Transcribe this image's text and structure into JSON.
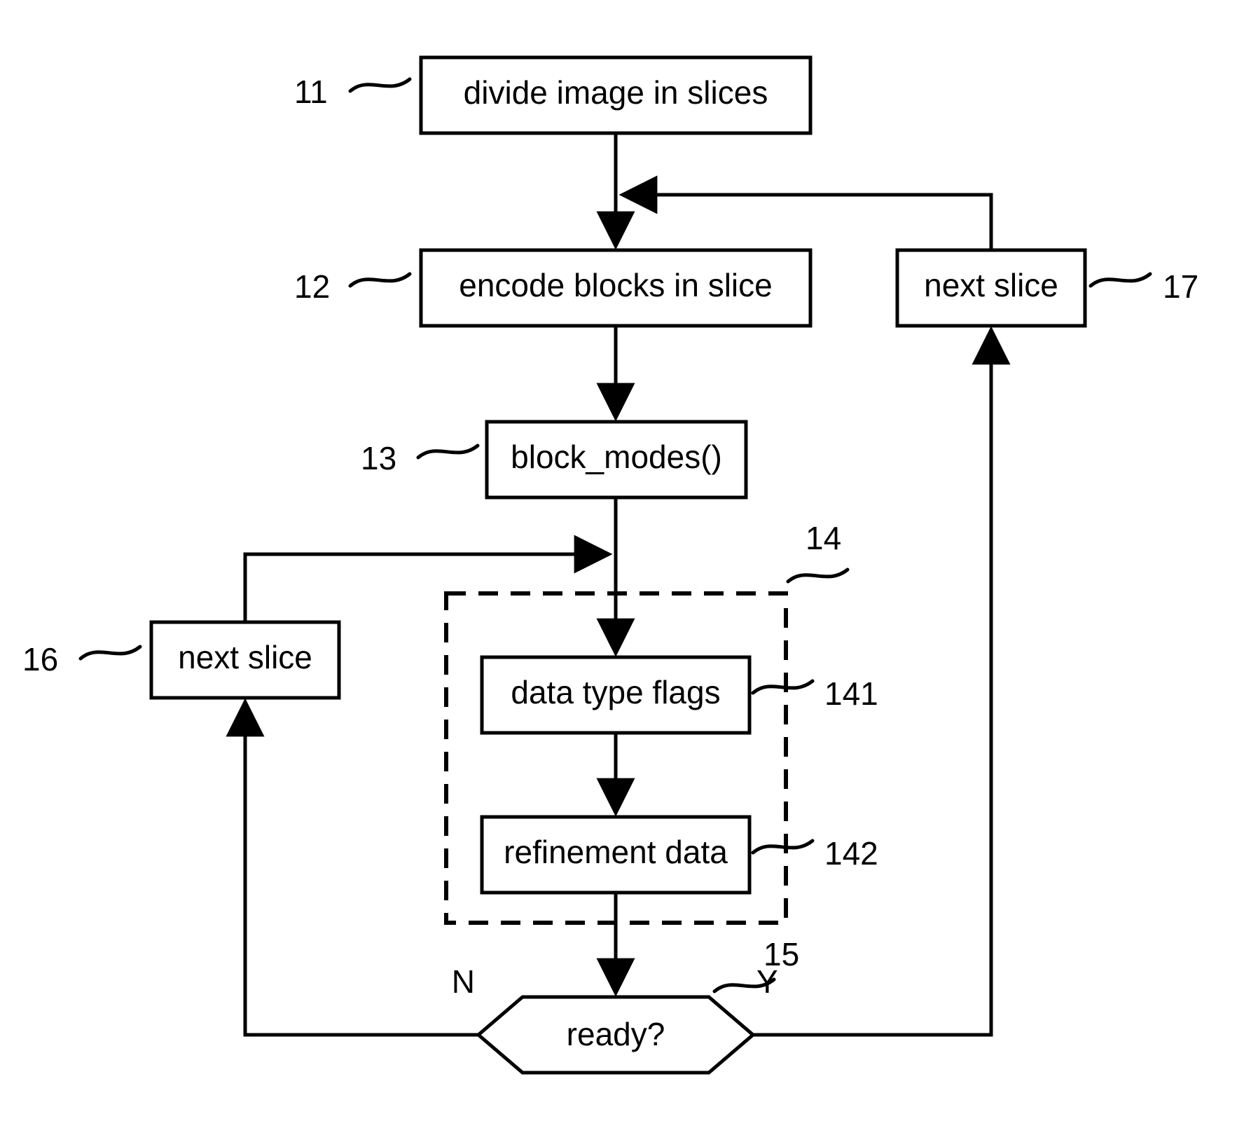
{
  "nodes": {
    "n11": {
      "id": "11",
      "text": "divide image in slices"
    },
    "n12": {
      "id": "12",
      "text": "encode blocks in slice"
    },
    "n13": {
      "id": "13",
      "text": "block_modes()"
    },
    "n14": {
      "id": "14"
    },
    "n141": {
      "id": "141",
      "text": "data type flags"
    },
    "n142": {
      "id": "142",
      "text": "refinement data"
    },
    "n15": {
      "id": "15",
      "text": "ready?"
    },
    "n16": {
      "id": "16",
      "text": "next slice"
    },
    "n17": {
      "id": "17",
      "text": "next slice"
    }
  },
  "branches": {
    "no": "N",
    "yes": "Y"
  }
}
